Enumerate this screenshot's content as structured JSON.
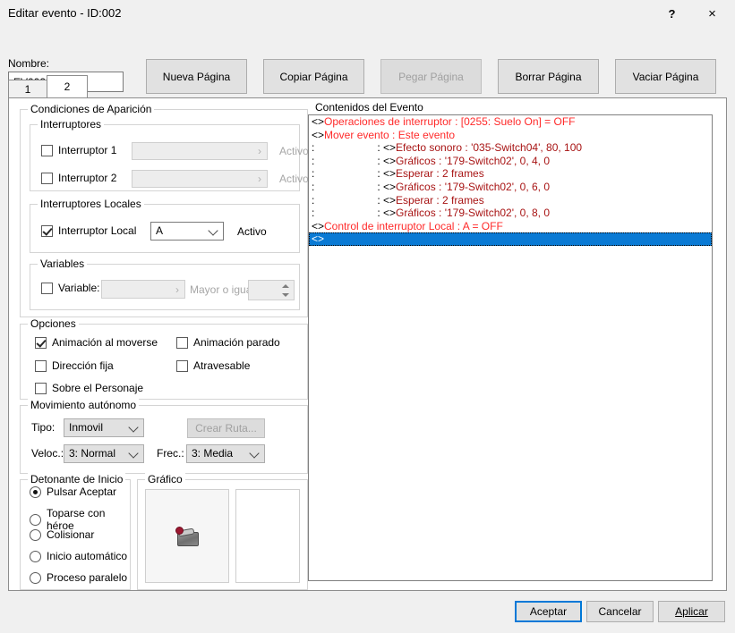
{
  "window": {
    "title": "Editar evento - ID:002",
    "help_label": "?",
    "close_label": "×"
  },
  "header": {
    "name_label": "Nombre:",
    "name_value": "EV002",
    "name_placeholder": "",
    "buttons": [
      {
        "label": "Nueva Página",
        "enabled": true
      },
      {
        "label": "Copiar Página",
        "enabled": true
      },
      {
        "label": "Pegar Página",
        "enabled": false
      },
      {
        "label": "Borrar Página",
        "enabled": true
      },
      {
        "label": "Vaciar Página",
        "enabled": true
      }
    ]
  },
  "tabs": [
    {
      "label": "1",
      "active": false
    },
    {
      "label": "2",
      "active": true
    }
  ],
  "conditions": {
    "title": "Condiciones de Aparición",
    "switches_group": {
      "title": "Interruptores",
      "rows": [
        {
          "label": "Interruptor 1",
          "checked": false,
          "field_value": "",
          "state_label": "Activo"
        },
        {
          "label": "Interruptor 2",
          "checked": false,
          "field_value": "",
          "state_label": "Activo"
        }
      ]
    },
    "local_switches_group": {
      "title": "Interruptores Locales",
      "label": "Interruptor Local",
      "checked": true,
      "selected": "A",
      "state_label": "Activo"
    },
    "variables_group": {
      "title": "Variables",
      "label": "Variable:",
      "checked": false,
      "field_value": "",
      "comparison": "Mayor o igual",
      "spin_value": ""
    }
  },
  "options": {
    "title": "Opciones",
    "items": [
      {
        "label": "Animación al moverse",
        "checked": true
      },
      {
        "label": "Animación parado",
        "checked": false
      },
      {
        "label": "Dirección fija",
        "checked": false
      },
      {
        "label": "Atravesable",
        "checked": false
      },
      {
        "label": "Sobre el Personaje",
        "checked": false
      }
    ]
  },
  "autonomous": {
    "title": "Movimiento autónomo",
    "type_label": "Tipo:",
    "type_value": "Inmovil",
    "route_button": "Crear Ruta...",
    "route_enabled": false,
    "speed_label": "Veloc.:",
    "speed_value": "3: Normal",
    "freq_label": "Frec.:",
    "freq_value": "3: Media"
  },
  "trigger": {
    "title": "Detonante de Inicio",
    "items": [
      {
        "label": "Pulsar Aceptar",
        "selected": true
      },
      {
        "label": "Toparse con héroe",
        "selected": false
      },
      {
        "label": "Colisionar",
        "selected": false
      },
      {
        "label": "Inicio automático",
        "selected": false
      },
      {
        "label": "Proceso paralelo",
        "selected": false
      }
    ]
  },
  "graphic": {
    "title": "Gráfico",
    "sprite_name": "switch-lever-sprite"
  },
  "event_contents": {
    "title": "Contenidos del Evento",
    "lines": [
      {
        "prefix": "<>",
        "text": "Operaciones de interruptor : [0255: Suelo On] = OFF",
        "indent": 0,
        "level": 0,
        "selected": false
      },
      {
        "prefix": "<>",
        "text": "Mover evento : Este evento",
        "indent": 0,
        "level": 0,
        "selected": false
      },
      {
        "prefix": ":                     : <>",
        "text": "Efecto sonoro : '035-Switch04', 80, 100",
        "indent": 1,
        "level": 1,
        "selected": false
      },
      {
        "prefix": ":                     : <>",
        "text": "Gráficos : '179-Switch02', 0, 4, 0",
        "indent": 1,
        "level": 1,
        "selected": false
      },
      {
        "prefix": ":                     : <>",
        "text": "Esperar : 2 frames",
        "indent": 1,
        "level": 1,
        "selected": false
      },
      {
        "prefix": ":                     : <>",
        "text": "Gráficos : '179-Switch02', 0, 6, 0",
        "indent": 1,
        "level": 1,
        "selected": false
      },
      {
        "prefix": ":                     : <>",
        "text": "Esperar : 2 frames",
        "indent": 1,
        "level": 1,
        "selected": false
      },
      {
        "prefix": ":                     : <>",
        "text": "Gráficos : '179-Switch02', 0, 8, 0",
        "indent": 1,
        "level": 1,
        "selected": false
      },
      {
        "prefix": "<>",
        "text": "Control de interruptor Local : A = OFF",
        "indent": 0,
        "level": 0,
        "selected": false
      },
      {
        "prefix": "<>",
        "text": "",
        "indent": 0,
        "level": 0,
        "selected": true
      }
    ]
  },
  "footer": {
    "ok": "Aceptar",
    "cancel": "Cancelar",
    "apply": "Aplicar"
  },
  "colors": {
    "accent": "#0078d7",
    "selection": "#0a7ad4",
    "command_top": "#ff2a2a",
    "command_nested": "#a81414",
    "window_bg": "#f0f0f0"
  }
}
